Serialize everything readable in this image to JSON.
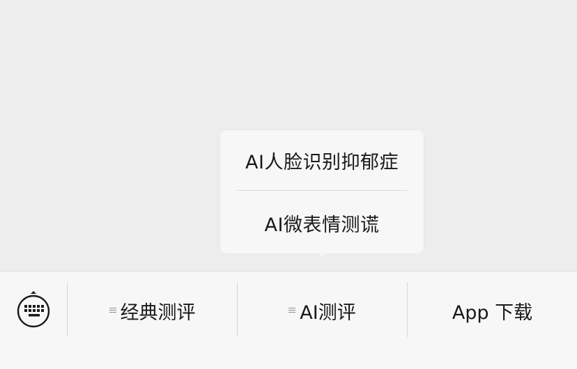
{
  "popup": {
    "items": [
      {
        "label": "AI人脸识别抑郁症"
      },
      {
        "label": "AI微表情测谎"
      }
    ]
  },
  "bottom_bar": {
    "keyboard_icon": "keyboard-icon",
    "menus": [
      {
        "label": "经典测评",
        "icon": "menu-lines-icon"
      },
      {
        "label": "AI测评",
        "icon": "menu-lines-icon"
      },
      {
        "label": "App 下载"
      }
    ]
  },
  "colors": {
    "background": "#ededed",
    "bar_background": "#f7f7f7",
    "popup_background": "#f7f7f7",
    "text": "#191919",
    "divider": "#d9d9d9"
  }
}
